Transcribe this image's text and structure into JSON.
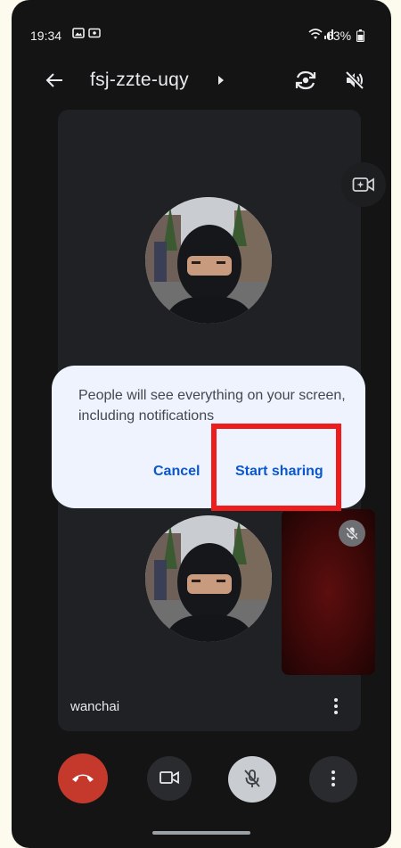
{
  "status_bar": {
    "time": "19:34",
    "battery": "63%",
    "icons": [
      "image-icon",
      "cast-icon",
      "wifi-icon",
      "signal-icon",
      "battery-icon"
    ]
  },
  "header": {
    "title": "fsj-zzte-uqy",
    "icons": [
      "back-arrow-icon",
      "caret-right-icon",
      "switch-camera-icon",
      "speaker-off-icon"
    ]
  },
  "dialog": {
    "message": "People will see everything on your screen, including notifications",
    "cancel_label": "Cancel",
    "confirm_label": "Start sharing",
    "highlight_color": "#ee1d1d",
    "accent_color": "#0b57d0"
  },
  "participant": {
    "name": "wanchai"
  },
  "controls": {
    "end_call_color": "#c5392c",
    "icons": [
      "end-call-icon",
      "camera-icon",
      "mic-off-icon",
      "more-vert-icon"
    ]
  }
}
